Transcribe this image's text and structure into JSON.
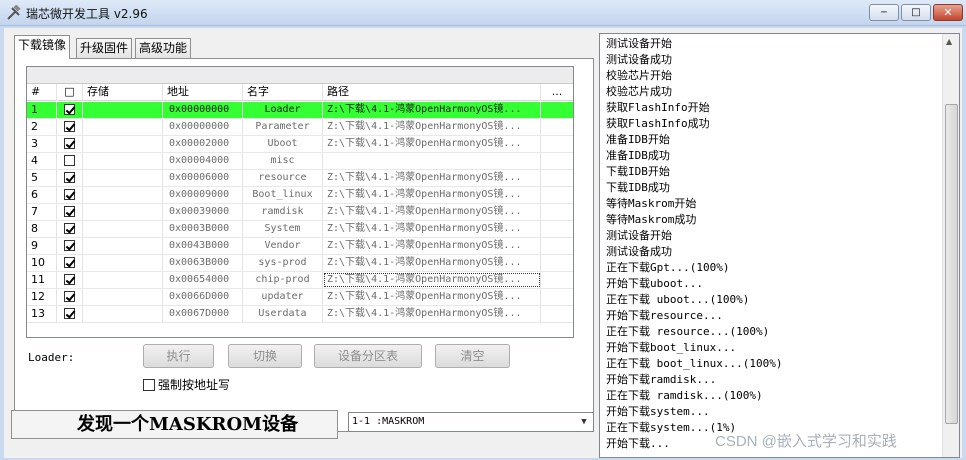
{
  "window": {
    "title": "瑞芯微开发工具 v2.96",
    "minimize": "─",
    "maximize": "□",
    "close": "✕"
  },
  "tabs": [
    {
      "label": "下载镜像"
    },
    {
      "label": "升级固件"
    },
    {
      "label": "高级功能"
    }
  ],
  "table": {
    "headers": [
      "#",
      "□",
      "存储",
      "地址",
      "名字",
      "路径",
      "..."
    ],
    "rows": [
      {
        "num": "1",
        "checked": true,
        "storage": "",
        "addr": "0x00000000",
        "name": "Loader",
        "path": "Z:\\下载\\4.1-鸿蒙OpenHarmonyOS镜..."
      },
      {
        "num": "2",
        "checked": true,
        "storage": "",
        "addr": "0x00000000",
        "name": "Parameter",
        "path": "Z:\\下载\\4.1-鸿蒙OpenHarmonyOS镜..."
      },
      {
        "num": "3",
        "checked": true,
        "storage": "",
        "addr": "0x00002000",
        "name": "Uboot",
        "path": "Z:\\下载\\4.1-鸿蒙OpenHarmonyOS镜..."
      },
      {
        "num": "4",
        "checked": false,
        "storage": "",
        "addr": "0x00004000",
        "name": "misc",
        "path": ""
      },
      {
        "num": "5",
        "checked": true,
        "storage": "",
        "addr": "0x00006000",
        "name": "resource",
        "path": "Z:\\下载\\4.1-鸿蒙OpenHarmonyOS镜..."
      },
      {
        "num": "6",
        "checked": true,
        "storage": "",
        "addr": "0x00009000",
        "name": "Boot_linux",
        "path": "Z:\\下载\\4.1-鸿蒙OpenHarmonyOS镜..."
      },
      {
        "num": "7",
        "checked": true,
        "storage": "",
        "addr": "0x00039000",
        "name": "ramdisk",
        "path": "Z:\\下载\\4.1-鸿蒙OpenHarmonyOS镜..."
      },
      {
        "num": "8",
        "checked": true,
        "storage": "",
        "addr": "0x0003B000",
        "name": "System",
        "path": "Z:\\下载\\4.1-鸿蒙OpenHarmonyOS镜..."
      },
      {
        "num": "9",
        "checked": true,
        "storage": "",
        "addr": "0x0043B000",
        "name": "Vendor",
        "path": "Z:\\下载\\4.1-鸿蒙OpenHarmonyOS镜..."
      },
      {
        "num": "10",
        "checked": true,
        "storage": "",
        "addr": "0x0063B000",
        "name": "sys-prod",
        "path": "Z:\\下载\\4.1-鸿蒙OpenHarmonyOS镜..."
      },
      {
        "num": "11",
        "checked": true,
        "storage": "",
        "addr": "0x00654000",
        "name": "chip-prod",
        "path": "Z:\\下载\\4.1-鸿蒙OpenHarmonyOS镜..."
      },
      {
        "num": "12",
        "checked": true,
        "storage": "",
        "addr": "0x0066D000",
        "name": "updater",
        "path": "Z:\\下载\\4.1-鸿蒙OpenHarmonyOS镜..."
      },
      {
        "num": "13",
        "checked": true,
        "storage": "",
        "addr": "0x0067D000",
        "name": "Userdata",
        "path": "Z:\\下载\\4.1-鸿蒙OpenHarmonyOS镜..."
      }
    ]
  },
  "controls": {
    "loader_label": "Loader:",
    "run": "执行",
    "switch": "切换",
    "partition_table": "设备分区表",
    "clear": "清空",
    "force_by_address": "强制按地址写"
  },
  "status": {
    "message": "发现一个MASKROM设备",
    "device": "1-1 :MASKROM"
  },
  "log": [
    "测试设备开始",
    "测试设备成功",
    "校验芯片开始",
    "校验芯片成功",
    "获取FlashInfo开始",
    "获取FlashInfo成功",
    "准备IDB开始",
    "准备IDB成功",
    "下载IDB开始",
    "下载IDB成功",
    "等待Maskrom开始",
    "等待Maskrom成功",
    "测试设备开始",
    "测试设备成功",
    "正在下载Gpt...(100%)",
    "开始下载uboot...",
    "正在下载 uboot...(100%)",
    "开始下载resource...",
    "正在下载 resource...(100%)",
    "开始下载boot_linux...",
    "正在下载 boot_linux...(100%)",
    "开始下载ramdisk...",
    "正在下载 ramdisk...(100%)",
    "开始下载system...",
    "正在下载system...(1%)",
    "开始下载..."
  ],
  "watermark": "CSDN @嵌入式学习和实践",
  "colors": {
    "selected_row": "#33ff33",
    "title_bar": "#c3d5ee"
  }
}
